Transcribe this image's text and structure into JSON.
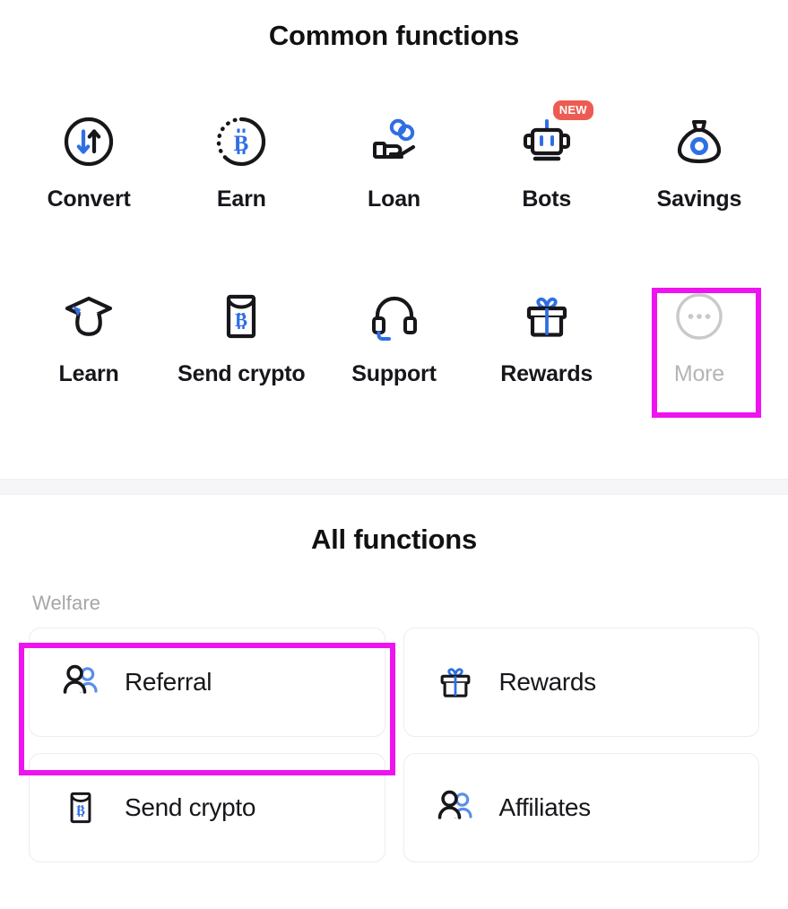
{
  "common_section": {
    "title": "Common functions",
    "items": [
      {
        "label": "Convert",
        "icon": "convert-circle-arrows-icon",
        "badge": null,
        "muted": false,
        "highlighted": false
      },
      {
        "label": "Earn",
        "icon": "earn-bitcoin-dashed-circle-icon",
        "badge": null,
        "muted": false,
        "highlighted": false
      },
      {
        "label": "Loan",
        "icon": "loan-hand-coins-icon",
        "badge": null,
        "muted": false,
        "highlighted": false
      },
      {
        "label": "Bots",
        "icon": "bots-robot-head-icon",
        "badge": "NEW",
        "muted": false,
        "highlighted": false
      },
      {
        "label": "Savings",
        "icon": "savings-money-bag-icon",
        "badge": null,
        "muted": false,
        "highlighted": false
      },
      {
        "label": "Learn",
        "icon": "learn-graduation-cap-icon",
        "badge": null,
        "muted": false,
        "highlighted": false
      },
      {
        "label": "Send crypto",
        "icon": "send-crypto-envelope-icon",
        "badge": null,
        "muted": false,
        "highlighted": false
      },
      {
        "label": "Support",
        "icon": "support-headset-icon",
        "badge": null,
        "muted": false,
        "highlighted": false
      },
      {
        "label": "Rewards",
        "icon": "rewards-gift-box-icon",
        "badge": null,
        "muted": false,
        "highlighted": false
      },
      {
        "label": "More",
        "icon": "more-ellipsis-circle-icon",
        "badge": null,
        "muted": true,
        "highlighted": true
      }
    ]
  },
  "all_section": {
    "title": "All functions",
    "groups": [
      {
        "label": "Welfare",
        "cards": [
          {
            "label": "Referral",
            "icon": "people-pair-icon",
            "highlighted": true
          },
          {
            "label": "Rewards",
            "icon": "rewards-gift-box-icon",
            "highlighted": false
          },
          {
            "label": "Send crypto",
            "icon": "send-crypto-envelope-icon",
            "highlighted": false
          },
          {
            "label": "Affiliates",
            "icon": "people-pair-icon",
            "highlighted": false
          }
        ]
      }
    ]
  },
  "colors": {
    "accent_blue": "#2f6fe4",
    "icon_black": "#17171b",
    "badge_red": "#ec5c52",
    "highlight_magenta": "#ef13ef",
    "muted_gray": "#b5b5b8",
    "card_border": "#ededf0",
    "divider": "#f6f6f8"
  }
}
